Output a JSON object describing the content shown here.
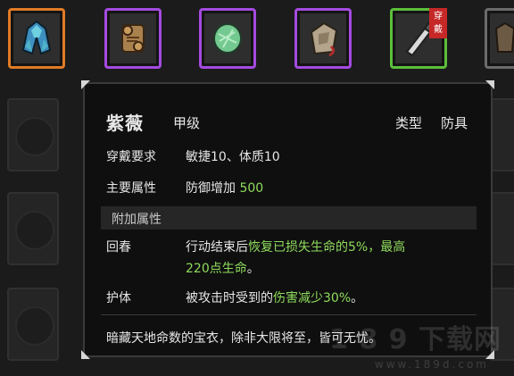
{
  "inventory": {
    "slots": [
      {
        "name": "blue-cloak",
        "rarity": "orange"
      },
      {
        "name": "scroll",
        "rarity": "purple"
      },
      {
        "name": "jade-stone",
        "rarity": "purple"
      },
      {
        "name": "cloth-pouch",
        "rarity": "purple"
      },
      {
        "name": "dagger",
        "rarity": "green",
        "badge": [
          "穿",
          "戴"
        ]
      },
      {
        "name": "armor",
        "rarity": "gray"
      }
    ]
  },
  "tooltip": {
    "name": "紫薇",
    "grade": "甲级",
    "type_label": "类型",
    "type_value": "防具",
    "requirement_label": "穿戴要求",
    "requirement_value": "敏捷10、体质10",
    "main_attr_label": "主要属性",
    "main_attr_text": "防御增加",
    "main_attr_value": "500",
    "extra_attr_header": "附加属性",
    "extra_attrs": [
      {
        "label": "回春",
        "prefix": "行动结束后",
        "highlight_line1": "恢复已损失生命的5%，最高",
        "highlight_line2": "220点生命",
        "suffix": "。"
      },
      {
        "label": "护体",
        "prefix": "被攻击时受到的",
        "highlight": "伤害减少30%",
        "suffix": "。"
      }
    ],
    "description": "暗藏天地命数的宝衣，除非大限将至，皆可无忧。"
  },
  "watermark": {
    "main": "1 8 9 下载网",
    "sub": "www.189d.com"
  },
  "colors": {
    "highlight": "#8fdc5c",
    "rarity_orange": "#e07b26",
    "rarity_purple": "#a44be0",
    "rarity_green": "#5bbf3b"
  }
}
